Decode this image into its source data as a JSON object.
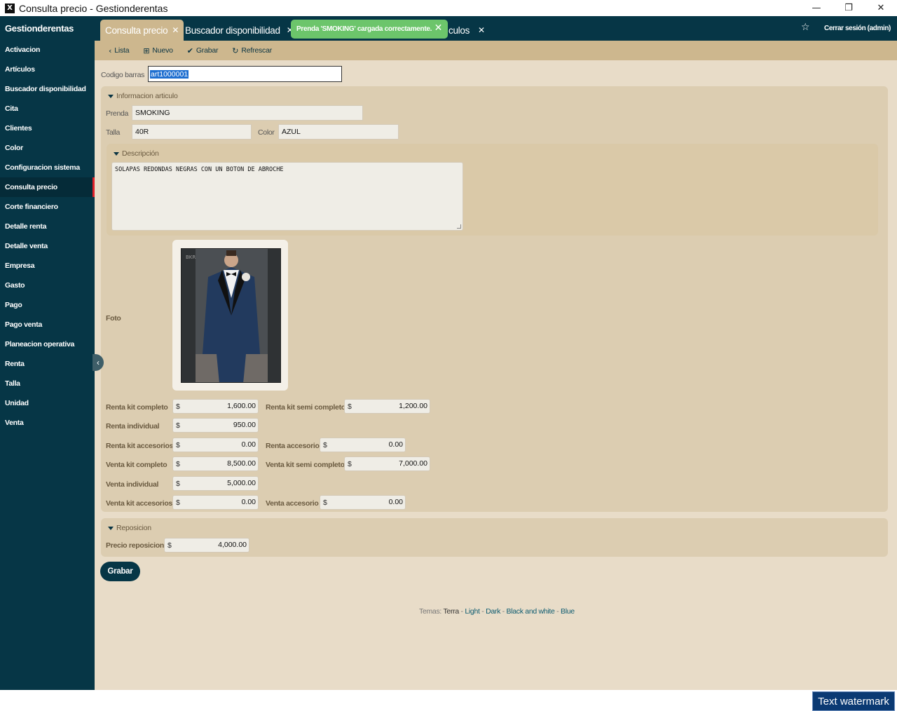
{
  "window": {
    "title": "Consulta precio - Gestionderentas",
    "app_icon": "X"
  },
  "window_controls": {
    "minimize": "—",
    "restore": "❐",
    "close": "✕"
  },
  "sidebar": {
    "brand": "Gestionderentas",
    "items": [
      {
        "label": "Activacion"
      },
      {
        "label": "Artículos"
      },
      {
        "label": "Buscador disponibilidad"
      },
      {
        "label": "Cita"
      },
      {
        "label": "Clientes"
      },
      {
        "label": "Color"
      },
      {
        "label": "Configuracion sistema"
      },
      {
        "label": "Consulta precio",
        "active": true
      },
      {
        "label": "Corte financiero"
      },
      {
        "label": "Detalle renta"
      },
      {
        "label": "Detalle venta"
      },
      {
        "label": "Empresa"
      },
      {
        "label": "Gasto"
      },
      {
        "label": "Pago"
      },
      {
        "label": "Pago venta"
      },
      {
        "label": "Planeacion operativa"
      },
      {
        "label": "Renta"
      },
      {
        "label": "Talla"
      },
      {
        "label": "Unidad"
      },
      {
        "label": "Venta"
      }
    ]
  },
  "tabs": [
    {
      "label": "Consulta precio",
      "active": true
    },
    {
      "label": "Buscador disponibilidad"
    },
    {
      "label": "culos"
    }
  ],
  "tab_close": "✕",
  "toast": {
    "message": "Prenda 'SMOKING' cargada correctamente.",
    "close": "✕"
  },
  "header": {
    "logout": "Cerrar sesión (admin)"
  },
  "toolbar": {
    "list": "Lista",
    "new": "Nuevo",
    "save": "Grabar",
    "refresh": "Refrescar"
  },
  "form": {
    "barcode_label": "Codigo barras",
    "barcode_value": "art1000001",
    "info_section": "Informacion articulo",
    "prenda_label": "Prenda",
    "prenda_value": "SMOKING",
    "talla_label": "Talla",
    "talla_value": "40R",
    "color_label": "Color",
    "color_value": "AZUL",
    "desc_section": "Descripción",
    "desc_value": "SOLAPAS REDONDAS NEGRAS CON UN BOTON DE ABROCHE",
    "foto_label": "Foto",
    "currency": "$",
    "prices": {
      "renta_kit_completo": {
        "label": "Renta kit completo",
        "value": "1,600.00"
      },
      "renta_kit_semi": {
        "label": "Renta kit semi completo",
        "value": "1,200.00"
      },
      "renta_individual": {
        "label": "Renta individual",
        "value": "950.00"
      },
      "renta_kit_acc": {
        "label": "Renta kit accesorios",
        "value": "0.00"
      },
      "renta_acc": {
        "label": "Renta accesorio",
        "value": "0.00"
      },
      "venta_kit_completo": {
        "label": "Venta kit completo",
        "value": "8,500.00"
      },
      "venta_kit_semi": {
        "label": "Venta kit semi completo",
        "value": "7,000.00"
      },
      "venta_individual": {
        "label": "Venta individual",
        "value": "5,000.00"
      },
      "venta_kit_acc": {
        "label": "Venta kit accesorios",
        "value": "0.00"
      },
      "venta_acc": {
        "label": "Venta accesorio",
        "value": "0.00"
      }
    },
    "repo_section": "Reposicion",
    "repo_label": "Precio reposicion",
    "repo_value": "4,000.00",
    "save_button": "Grabar"
  },
  "themes": {
    "label": "Temas:",
    "current": "Terra",
    "options": [
      "Light",
      "Dark",
      "Black and white",
      "Blue"
    ]
  },
  "watermark": "Text watermark",
  "colors": {
    "sidebar": "#063646",
    "accent": "#cdb78e",
    "content": "#e8dcc8",
    "toast": "#6cc56b"
  }
}
